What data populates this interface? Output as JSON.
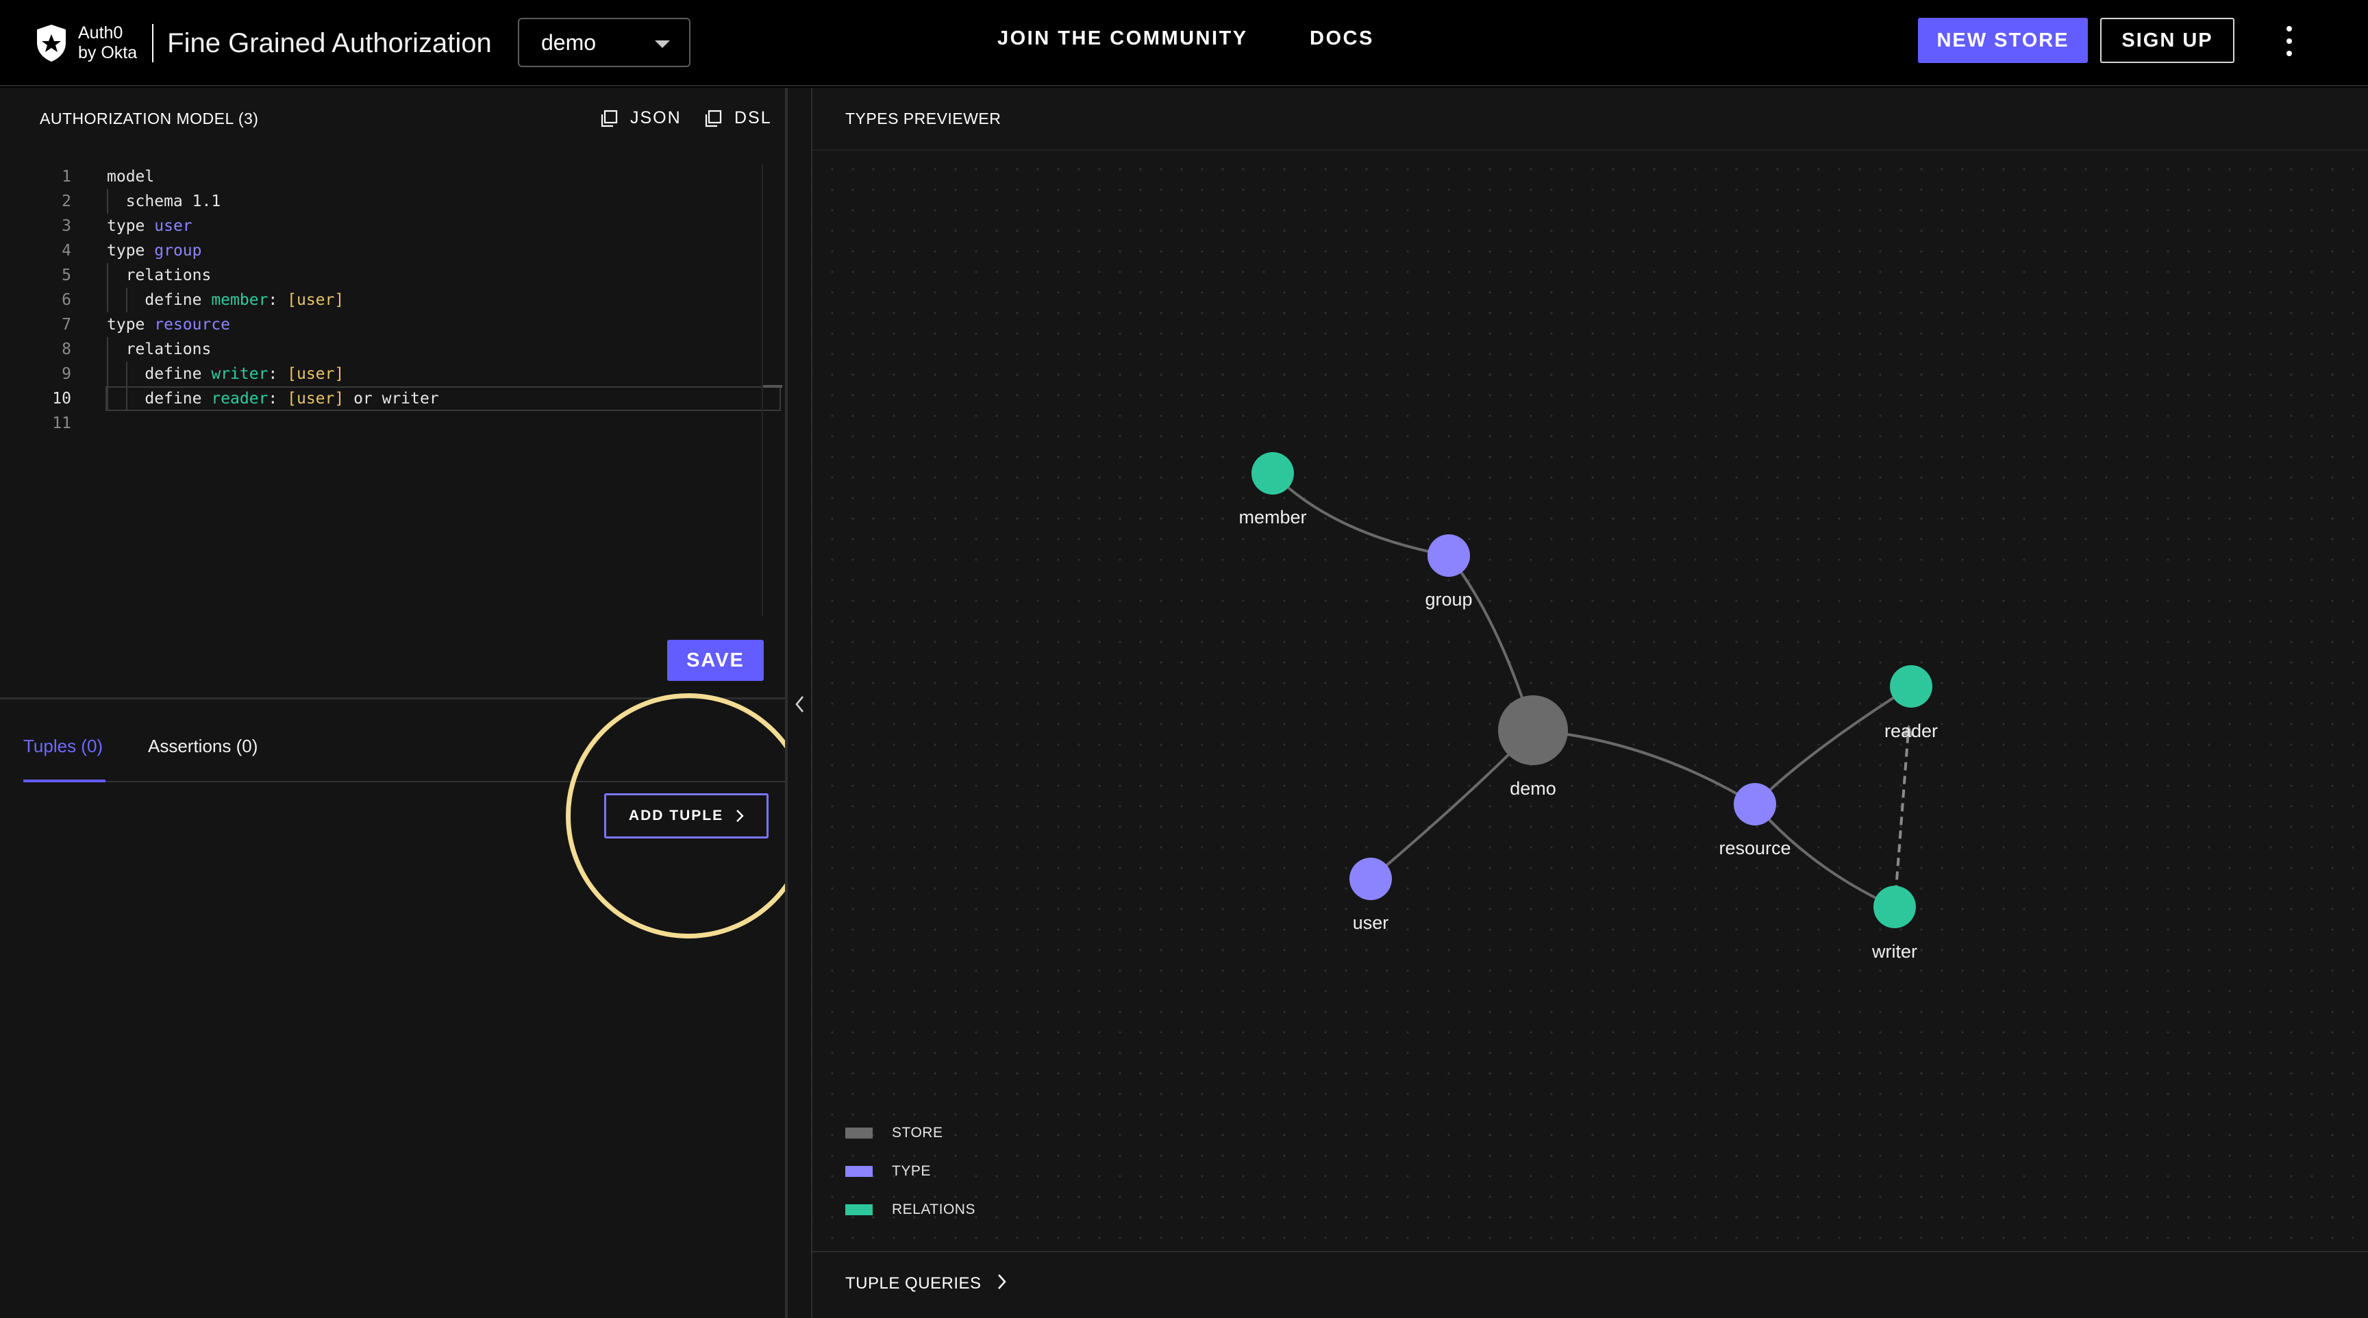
{
  "header": {
    "brand_line1": "Auth0",
    "brand_line2": "by Okta",
    "app_title": "Fine Grained Authorization",
    "store_selected": "demo",
    "nav": {
      "community": "JOIN  THE COMMUNITY",
      "docs": "DOCS"
    },
    "new_store": "NEW STORE",
    "sign_up": "SIGN UP",
    "menu_icon": "kebab-menu-icon"
  },
  "editor": {
    "title": "AUTHORIZATION MODEL (3)",
    "copy_json": "JSON",
    "copy_dsl": "DSL",
    "active_line": 10,
    "lines": [
      {
        "n": "1",
        "tokens": [
          [
            "kw",
            "model"
          ]
        ]
      },
      {
        "n": "2",
        "tokens": [
          [
            "kw",
            "  schema "
          ],
          [
            "kw",
            "1.1"
          ]
        ]
      },
      {
        "n": "3",
        "tokens": [
          [
            "kw",
            "type "
          ],
          [
            "type-name",
            "user"
          ]
        ]
      },
      {
        "n": "4",
        "tokens": [
          [
            "kw",
            "type "
          ],
          [
            "type-name",
            "group"
          ]
        ]
      },
      {
        "n": "5",
        "tokens": [
          [
            "kw",
            "  relations"
          ]
        ]
      },
      {
        "n": "6",
        "tokens": [
          [
            "kw",
            "    define "
          ],
          [
            "rel-name",
            "member"
          ],
          [
            "kw",
            ": "
          ],
          [
            "bracket",
            "[user]"
          ]
        ]
      },
      {
        "n": "7",
        "tokens": [
          [
            "kw",
            "type "
          ],
          [
            "type-name",
            "resource"
          ]
        ]
      },
      {
        "n": "8",
        "tokens": [
          [
            "kw",
            "  relations"
          ]
        ]
      },
      {
        "n": "9",
        "tokens": [
          [
            "kw",
            "    define "
          ],
          [
            "rel-name",
            "writer"
          ],
          [
            "kw",
            ": "
          ],
          [
            "bracket",
            "[user]"
          ]
        ]
      },
      {
        "n": "10",
        "tokens": [
          [
            "kw",
            "    define "
          ],
          [
            "rel-name",
            "reader"
          ],
          [
            "kw",
            ": "
          ],
          [
            "bracket",
            "[user]"
          ],
          [
            "kw",
            " or writer"
          ]
        ]
      },
      {
        "n": "11",
        "tokens": []
      }
    ],
    "save": "SAVE"
  },
  "tabs": {
    "tuples": "Tuples (0)",
    "assertions": "Assertions (0)"
  },
  "add_tuple": "ADD TUPLE",
  "previewer": {
    "title": "TYPES PREVIEWER",
    "nodes": {
      "member": "member",
      "group": "group",
      "demo": "demo",
      "user": "user",
      "resource": "resource",
      "reader": "reader",
      "writer": "writer"
    },
    "legend": {
      "store": "STORE",
      "type": "TYPE",
      "relations": "RELATIONS"
    },
    "colors": {
      "store": "#6b6b6b",
      "type": "#8c84ff",
      "relation": "#2ec79b",
      "accent": "#635dff"
    }
  },
  "tuple_queries": "TUPLE QUERIES"
}
